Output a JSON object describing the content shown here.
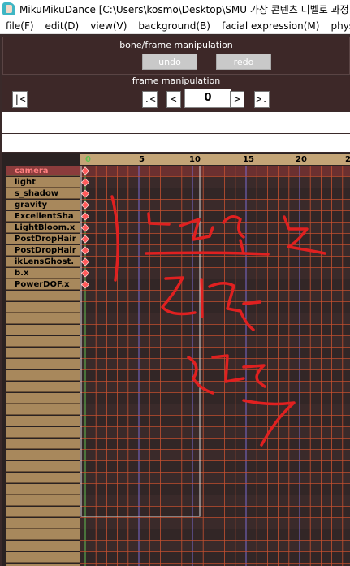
{
  "window": {
    "title": "MikuMikuDance [C:\\Users\\kosmo\\Desktop\\SMU 가상 콘텐츠 디벨로 과정"
  },
  "menu": [
    {
      "label": "file(F)"
    },
    {
      "label": "edit(D)"
    },
    {
      "label": "view(V)"
    },
    {
      "label": "background(B)"
    },
    {
      "label": "facial expression(M)"
    },
    {
      "label": "physical op"
    }
  ],
  "bone_panel": {
    "caption": "bone/frame manipulation",
    "undo_label": "undo",
    "redo_label": "redo"
  },
  "frame_panel": {
    "caption": "frame manipulation",
    "first_label": "|<",
    "prev_key_label": ".<",
    "prev_label": "<",
    "frame_value": "0",
    "next_label": ">",
    "next_key_label": ">."
  },
  "timeline": {
    "ticks": [
      "0",
      "5",
      "10",
      "15",
      "20",
      "2"
    ],
    "tracks": [
      {
        "label": "camera",
        "active": true
      },
      {
        "label": "light"
      },
      {
        "label": "s_shadow"
      },
      {
        "label": "gravity"
      },
      {
        "label": "ExcellentSha"
      },
      {
        "label": "LightBloom.x"
      },
      {
        "label": "PostDropHair"
      },
      {
        "label": "PostDropHair"
      },
      {
        "label": "ikLensGhost."
      },
      {
        "label": "b.x"
      },
      {
        "label": "PowerDOF.x"
      }
    ],
    "colors": {
      "grid_line": "#c45030",
      "grid_bg": "#2a2222",
      "row_fill": "#3a2a2a",
      "keyframe": "#ff5a5a",
      "selection_box": "#d9d9d9",
      "annotation": "#e02020"
    }
  }
}
